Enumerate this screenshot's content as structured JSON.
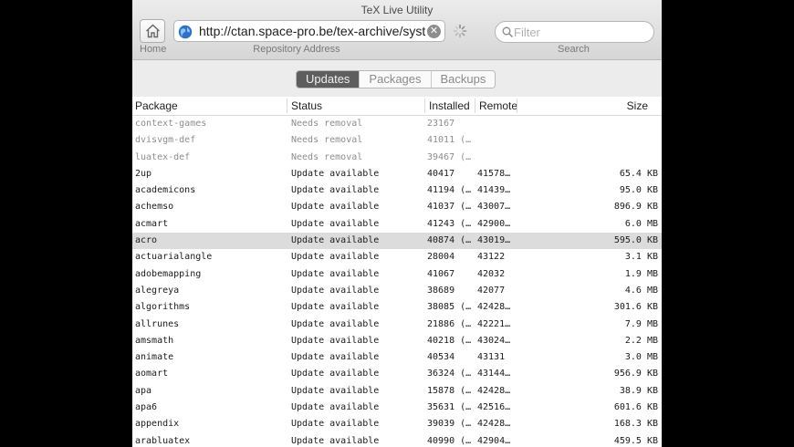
{
  "window": {
    "title": "TeX Live Utility"
  },
  "toolbar": {
    "home_label": "Home",
    "repo_label": "Repository Address",
    "search_label": "Search",
    "address": "http://ctan.space-pro.be/tex-archive/systems/texlive/tlnet",
    "search_placeholder": "Filter"
  },
  "tabs": [
    {
      "label": "Updates",
      "active": true
    },
    {
      "label": "Packages",
      "active": false
    },
    {
      "label": "Backups",
      "active": false
    }
  ],
  "table": {
    "headers": {
      "package": "Package",
      "status": "Status",
      "installed": "Installed",
      "remote": "Remote",
      "size": "Size"
    },
    "rows": [
      {
        "package": "context-games",
        "status": "Needs removal",
        "installed": "23167",
        "remote": "",
        "size": "",
        "dim": true
      },
      {
        "package": "dvisvgm-def",
        "status": "Needs removal",
        "installed": "41011 (…",
        "remote": "",
        "size": "",
        "dim": true
      },
      {
        "package": "luatex-def",
        "status": "Needs removal",
        "installed": "39467 (…",
        "remote": "",
        "size": "",
        "dim": true
      },
      {
        "package": "2up",
        "status": "Update available",
        "installed": "40417",
        "remote": "41578…",
        "size": "65.4 KB"
      },
      {
        "package": "academicons",
        "status": "Update available",
        "installed": "41194 (…",
        "remote": "41439…",
        "size": "95.0 KB"
      },
      {
        "package": "achemso",
        "status": "Update available",
        "installed": "41037 (…",
        "remote": "43007…",
        "size": "896.9 KB"
      },
      {
        "package": "acmart",
        "status": "Update available",
        "installed": "41243 (…",
        "remote": "42900…",
        "size": "6.0 MB"
      },
      {
        "package": "acro",
        "status": "Update available",
        "installed": "40874 (…",
        "remote": "43019…",
        "size": "595.0 KB",
        "selected": true
      },
      {
        "package": "actuarialangle",
        "status": "Update available",
        "installed": "28004",
        "remote": "43122",
        "size": "3.1 KB"
      },
      {
        "package": "adobemapping",
        "status": "Update available",
        "installed": "41067",
        "remote": "42032",
        "size": "1.9 MB"
      },
      {
        "package": "alegreya",
        "status": "Update available",
        "installed": "38689",
        "remote": "42077",
        "size": "4.6 MB"
      },
      {
        "package": "algorithms",
        "status": "Update available",
        "installed": "38085 (…",
        "remote": "42428…",
        "size": "301.6 KB"
      },
      {
        "package": "allrunes",
        "status": "Update available",
        "installed": "21886 (…",
        "remote": "42221…",
        "size": "7.9 MB"
      },
      {
        "package": "amsmath",
        "status": "Update available",
        "installed": "40218 (…",
        "remote": "43024…",
        "size": "2.2 MB"
      },
      {
        "package": "animate",
        "status": "Update available",
        "installed": "40534",
        "remote": "43131",
        "size": "3.0 MB"
      },
      {
        "package": "aomart",
        "status": "Update available",
        "installed": "36324 (…",
        "remote": "43144…",
        "size": "956.9 KB"
      },
      {
        "package": "apa",
        "status": "Update available",
        "installed": "15878 (…",
        "remote": "42428…",
        "size": "38.9 KB"
      },
      {
        "package": "apa6",
        "status": "Update available",
        "installed": "35631 (…",
        "remote": "42516…",
        "size": "601.6 KB"
      },
      {
        "package": "appendix",
        "status": "Update available",
        "installed": "39039 (…",
        "remote": "42428…",
        "size": "168.3 KB"
      },
      {
        "package": "arabluatex",
        "status": "Update available",
        "installed": "40990 (…",
        "remote": "42904…",
        "size": "459.5 KB"
      }
    ]
  }
}
